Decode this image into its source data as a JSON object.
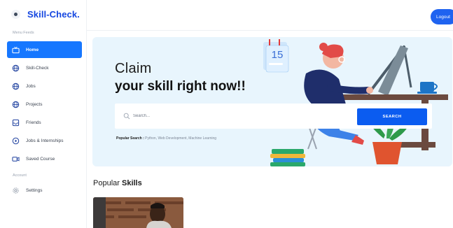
{
  "brand": {
    "name": "Skill-Check."
  },
  "sidebar": {
    "menu_label": "Menu Feeds",
    "items": [
      {
        "label": "Home",
        "icon": "tv-icon",
        "active": true
      },
      {
        "label": "Skill-Check",
        "icon": "globe-icon"
      },
      {
        "label": "Jobs",
        "icon": "globe-icon"
      },
      {
        "label": "Projects",
        "icon": "globe-icon"
      },
      {
        "label": "Friends",
        "icon": "inbox-icon"
      },
      {
        "label": "Jobs & Internships",
        "icon": "play-circle-icon"
      },
      {
        "label": "Saved Course",
        "icon": "video-icon"
      }
    ],
    "account_label": "Account",
    "settings_label": "Settings"
  },
  "header": {
    "logout_label": "Logout"
  },
  "hero": {
    "title_line1": "Claim",
    "title_line2": "your skill right now!!",
    "search_placeholder": "Search...",
    "search_button": "SEARCH",
    "popular_search_label": "Popular Search :",
    "popular_search_values": "Python, Web Development, Machine Learning",
    "calendar_number": "15"
  },
  "skills": {
    "heading_prefix": "Popular",
    "heading_bold": "Skills"
  },
  "colors": {
    "accent": "#1677ff",
    "brand": "#1446e0",
    "hero_bg": "#e8f5fd",
    "search_button": "#0b5cf0"
  }
}
